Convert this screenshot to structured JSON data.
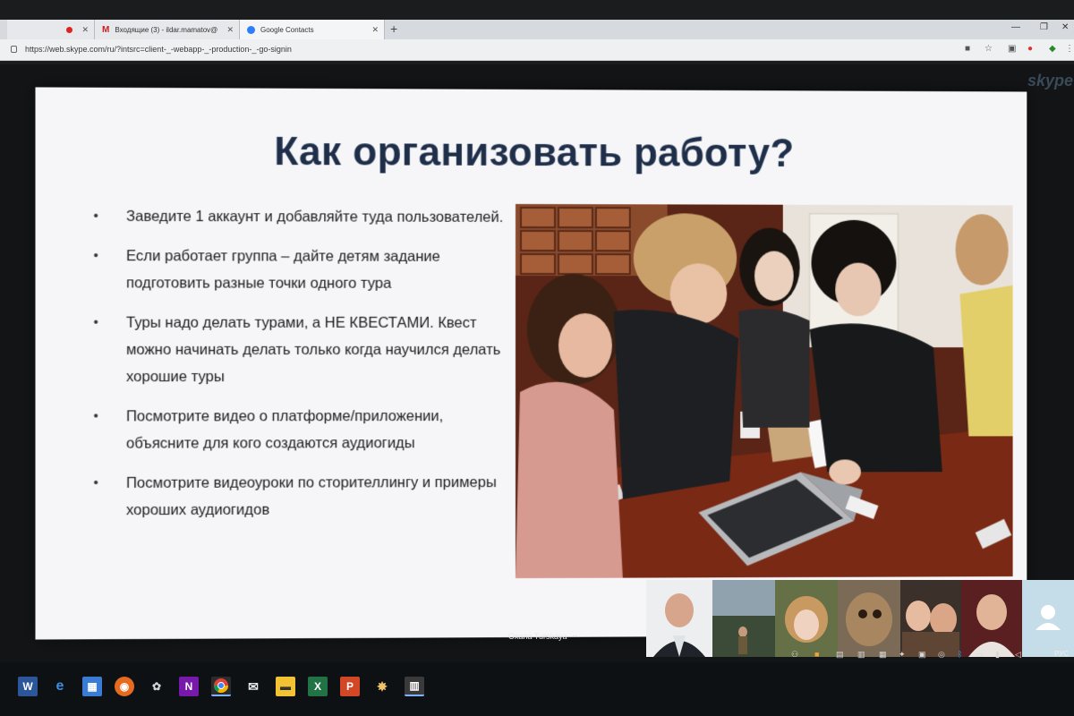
{
  "browser": {
    "tabs": [
      {
        "label": ""
      },
      {
        "label": "Входящие (3) - ildar.mamatov@"
      },
      {
        "label": "Google Contacts"
      }
    ],
    "new_tab": "+",
    "url": "https://web.skype.com/ru/?intsrc=client-_-webapp-_-production-_-go-signin"
  },
  "skype": {
    "logo": "skype"
  },
  "slide": {
    "title": "Как организовать работу?",
    "bullets": [
      "Заведите 1 аккаунт и добавляйте туда пользователей.",
      "Если работает группа – дайте детям задание подготовить разные точки одного тура",
      "Туры надо делать турами, а НЕ КВЕСТАМИ. Квест можно начинать делать только когда научился делать хорошие туры",
      "Посмотрите видео о платформе/приложении, объясните для кого создаются аудиогиды",
      "Посмотрите видеоуроки по сторителлингу и примеры хороших аудиогидов"
    ]
  },
  "call": {
    "presenter_name": "Oxana Turskaya"
  },
  "taskbar": {
    "apps": [
      "word",
      "edge",
      "store",
      "firefox",
      "paint",
      "onenote",
      "chrome",
      "mail",
      "explorer",
      "excel",
      "powerpoint",
      "paint3d",
      "other"
    ],
    "language": "РУС"
  }
}
